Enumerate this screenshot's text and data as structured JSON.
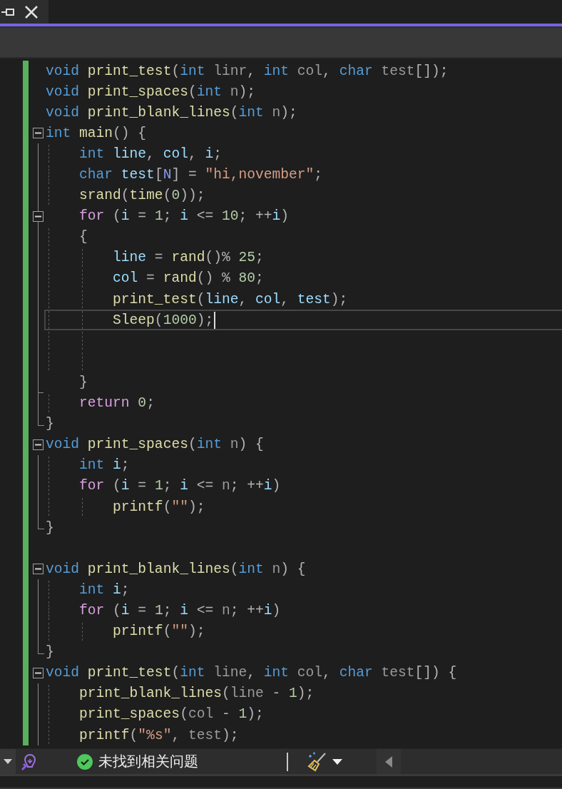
{
  "editor": {
    "lines": [
      {
        "fold_start": false,
        "fold_end": false,
        "current": false,
        "tokens": [
          {
            "kind": "keyword",
            "text": "void"
          },
          {
            "kind": "function",
            "text": " print_test"
          },
          {
            "kind": "punct",
            "text": "("
          },
          {
            "kind": "keyword",
            "text": "int"
          },
          {
            "kind": "param",
            "text": " linr"
          },
          {
            "kind": "punct",
            "text": ", "
          },
          {
            "kind": "keyword",
            "text": "int"
          },
          {
            "kind": "param",
            "text": " col"
          },
          {
            "kind": "punct",
            "text": ", "
          },
          {
            "kind": "keyword",
            "text": "char"
          },
          {
            "kind": "param",
            "text": " test"
          },
          {
            "kind": "punct",
            "text": "[]);"
          }
        ]
      },
      {
        "fold_start": false,
        "fold_end": false,
        "current": false,
        "tokens": [
          {
            "kind": "keyword",
            "text": "void"
          },
          {
            "kind": "function",
            "text": " print_spaces"
          },
          {
            "kind": "punct",
            "text": "("
          },
          {
            "kind": "keyword",
            "text": "int"
          },
          {
            "kind": "param",
            "text": " n"
          },
          {
            "kind": "punct",
            "text": ");"
          }
        ]
      },
      {
        "fold_start": false,
        "fold_end": false,
        "current": false,
        "tokens": [
          {
            "kind": "keyword",
            "text": "void"
          },
          {
            "kind": "function",
            "text": " print_blank_lines"
          },
          {
            "kind": "punct",
            "text": "("
          },
          {
            "kind": "keyword",
            "text": "int"
          },
          {
            "kind": "param",
            "text": " n"
          },
          {
            "kind": "punct",
            "text": ");"
          }
        ]
      },
      {
        "fold_start": true,
        "fold_end": false,
        "current": false,
        "tokens": [
          {
            "kind": "keyword",
            "text": "int"
          },
          {
            "kind": "function",
            "text": " main"
          },
          {
            "kind": "punct",
            "text": "() {"
          }
        ]
      },
      {
        "fold_start": false,
        "fold_end": false,
        "current": false,
        "tokens": [
          {
            "kind": "keyword",
            "text": "    int"
          },
          {
            "kind": "variable",
            "text": " line"
          },
          {
            "kind": "punct",
            "text": ", "
          },
          {
            "kind": "variable",
            "text": "col"
          },
          {
            "kind": "punct",
            "text": ", "
          },
          {
            "kind": "variable",
            "text": "i"
          },
          {
            "kind": "punct",
            "text": ";"
          }
        ]
      },
      {
        "fold_start": false,
        "fold_end": false,
        "current": false,
        "tokens": [
          {
            "kind": "keyword",
            "text": "    char"
          },
          {
            "kind": "variable",
            "text": " test"
          },
          {
            "kind": "punct",
            "text": "["
          },
          {
            "kind": "macro",
            "text": "N"
          },
          {
            "kind": "punct",
            "text": "] = "
          },
          {
            "kind": "string",
            "text": "\"hi,november\""
          },
          {
            "kind": "punct",
            "text": ";"
          }
        ]
      },
      {
        "fold_start": false,
        "fold_end": false,
        "current": false,
        "tokens": [
          {
            "kind": "function",
            "text": "    srand"
          },
          {
            "kind": "punct",
            "text": "("
          },
          {
            "kind": "function",
            "text": "time"
          },
          {
            "kind": "punct",
            "text": "("
          },
          {
            "kind": "number",
            "text": "0"
          },
          {
            "kind": "punct",
            "text": "));"
          }
        ]
      },
      {
        "fold_start": true,
        "fold_end": false,
        "current": false,
        "tokens": [
          {
            "kind": "control",
            "text": "    for"
          },
          {
            "kind": "punct",
            "text": " ("
          },
          {
            "kind": "variable",
            "text": "i"
          },
          {
            "kind": "punct",
            "text": " = "
          },
          {
            "kind": "number",
            "text": "1"
          },
          {
            "kind": "punct",
            "text": "; "
          },
          {
            "kind": "variable",
            "text": "i"
          },
          {
            "kind": "punct",
            "text": " <= "
          },
          {
            "kind": "number",
            "text": "10"
          },
          {
            "kind": "punct",
            "text": "; ++"
          },
          {
            "kind": "variable",
            "text": "i"
          },
          {
            "kind": "punct",
            "text": ")"
          }
        ]
      },
      {
        "fold_start": false,
        "fold_end": false,
        "current": false,
        "tokens": [
          {
            "kind": "punct",
            "text": "    {"
          }
        ]
      },
      {
        "fold_start": false,
        "fold_end": false,
        "current": false,
        "tokens": [
          {
            "kind": "variable",
            "text": "        line"
          },
          {
            "kind": "punct",
            "text": " = "
          },
          {
            "kind": "function",
            "text": "rand"
          },
          {
            "kind": "punct",
            "text": "()% "
          },
          {
            "kind": "number",
            "text": "25"
          },
          {
            "kind": "punct",
            "text": ";"
          }
        ]
      },
      {
        "fold_start": false,
        "fold_end": false,
        "current": false,
        "tokens": [
          {
            "kind": "variable",
            "text": "        col"
          },
          {
            "kind": "punct",
            "text": " = "
          },
          {
            "kind": "function",
            "text": "rand"
          },
          {
            "kind": "punct",
            "text": "() % "
          },
          {
            "kind": "number",
            "text": "80"
          },
          {
            "kind": "punct",
            "text": ";"
          }
        ]
      },
      {
        "fold_start": false,
        "fold_end": false,
        "current": false,
        "tokens": [
          {
            "kind": "function",
            "text": "        print_test"
          },
          {
            "kind": "punct",
            "text": "("
          },
          {
            "kind": "variable",
            "text": "line"
          },
          {
            "kind": "punct",
            "text": ", "
          },
          {
            "kind": "variable",
            "text": "col"
          },
          {
            "kind": "punct",
            "text": ", "
          },
          {
            "kind": "variable",
            "text": "test"
          },
          {
            "kind": "punct",
            "text": ");"
          }
        ]
      },
      {
        "fold_start": false,
        "fold_end": false,
        "current": true,
        "tokens": [
          {
            "kind": "function",
            "text": "        Sleep"
          },
          {
            "kind": "punct",
            "text": "("
          },
          {
            "kind": "number",
            "text": "1000"
          },
          {
            "kind": "punct",
            "text": ");"
          }
        ]
      },
      {
        "fold_start": false,
        "fold_end": false,
        "current": false
      },
      {
        "fold_start": false,
        "fold_end": false,
        "current": false
      },
      {
        "fold_start": false,
        "fold_end": true,
        "current": false,
        "tokens": [
          {
            "kind": "punct",
            "text": "    }"
          }
        ]
      },
      {
        "fold_start": false,
        "fold_end": false,
        "current": false,
        "tokens": [
          {
            "kind": "control",
            "text": "    return"
          },
          {
            "kind": "number",
            "text": " 0"
          },
          {
            "kind": "punct",
            "text": ";"
          }
        ]
      },
      {
        "fold_start": false,
        "fold_end": true,
        "current": false,
        "tokens": [
          {
            "kind": "punct",
            "text": "}"
          }
        ]
      },
      {
        "fold_start": true,
        "fold_end": false,
        "current": false,
        "tokens": [
          {
            "kind": "keyword",
            "text": "void"
          },
          {
            "kind": "function",
            "text": " print_spaces"
          },
          {
            "kind": "punct",
            "text": "("
          },
          {
            "kind": "keyword",
            "text": "int"
          },
          {
            "kind": "param",
            "text": " n"
          },
          {
            "kind": "punct",
            "text": ") {"
          }
        ]
      },
      {
        "fold_start": false,
        "fold_end": false,
        "current": false,
        "tokens": [
          {
            "kind": "keyword",
            "text": "    int"
          },
          {
            "kind": "variable",
            "text": " i"
          },
          {
            "kind": "punct",
            "text": ";"
          }
        ]
      },
      {
        "fold_start": false,
        "fold_end": false,
        "current": false,
        "tokens": [
          {
            "kind": "control",
            "text": "    for"
          },
          {
            "kind": "punct",
            "text": " ("
          },
          {
            "kind": "variable",
            "text": "i"
          },
          {
            "kind": "punct",
            "text": " = "
          },
          {
            "kind": "number",
            "text": "1"
          },
          {
            "kind": "punct",
            "text": "; "
          },
          {
            "kind": "variable",
            "text": "i"
          },
          {
            "kind": "punct",
            "text": " <= "
          },
          {
            "kind": "param",
            "text": "n"
          },
          {
            "kind": "punct",
            "text": "; ++"
          },
          {
            "kind": "variable",
            "text": "i"
          },
          {
            "kind": "punct",
            "text": ")"
          }
        ]
      },
      {
        "fold_start": false,
        "fold_end": false,
        "current": false,
        "tokens": [
          {
            "kind": "function",
            "text": "        printf"
          },
          {
            "kind": "punct",
            "text": "("
          },
          {
            "kind": "string",
            "text": "\"\""
          },
          {
            "kind": "punct",
            "text": ");"
          }
        ]
      },
      {
        "fold_start": false,
        "fold_end": true,
        "current": false,
        "tokens": [
          {
            "kind": "punct",
            "text": "}"
          }
        ]
      },
      {
        "fold_start": false,
        "fold_end": false,
        "current": false
      },
      {
        "fold_start": true,
        "fold_end": false,
        "current": false,
        "tokens": [
          {
            "kind": "keyword",
            "text": "void"
          },
          {
            "kind": "function",
            "text": " print_blank_lines"
          },
          {
            "kind": "punct",
            "text": "("
          },
          {
            "kind": "keyword",
            "text": "int"
          },
          {
            "kind": "param",
            "text": " n"
          },
          {
            "kind": "punct",
            "text": ") {"
          }
        ]
      },
      {
        "fold_start": false,
        "fold_end": false,
        "current": false,
        "tokens": [
          {
            "kind": "keyword",
            "text": "    int"
          },
          {
            "kind": "variable",
            "text": " i"
          },
          {
            "kind": "punct",
            "text": ";"
          }
        ]
      },
      {
        "fold_start": false,
        "fold_end": false,
        "current": false,
        "tokens": [
          {
            "kind": "control",
            "text": "    for"
          },
          {
            "kind": "punct",
            "text": " ("
          },
          {
            "kind": "variable",
            "text": "i"
          },
          {
            "kind": "punct",
            "text": " = "
          },
          {
            "kind": "number",
            "text": "1"
          },
          {
            "kind": "punct",
            "text": "; "
          },
          {
            "kind": "variable",
            "text": "i"
          },
          {
            "kind": "punct",
            "text": " <= "
          },
          {
            "kind": "param",
            "text": "n"
          },
          {
            "kind": "punct",
            "text": "; ++"
          },
          {
            "kind": "variable",
            "text": "i"
          },
          {
            "kind": "punct",
            "text": ")"
          }
        ]
      },
      {
        "fold_start": false,
        "fold_end": false,
        "current": false,
        "tokens": [
          {
            "kind": "function",
            "text": "        printf"
          },
          {
            "kind": "punct",
            "text": "("
          },
          {
            "kind": "string",
            "text": "\"\""
          },
          {
            "kind": "punct",
            "text": ");"
          }
        ]
      },
      {
        "fold_start": false,
        "fold_end": true,
        "current": false,
        "tokens": [
          {
            "kind": "punct",
            "text": "}"
          }
        ]
      },
      {
        "fold_start": true,
        "fold_end": false,
        "current": false,
        "tokens": [
          {
            "kind": "keyword",
            "text": "void"
          },
          {
            "kind": "function",
            "text": " print_test"
          },
          {
            "kind": "punct",
            "text": "("
          },
          {
            "kind": "keyword",
            "text": "int"
          },
          {
            "kind": "param",
            "text": " line"
          },
          {
            "kind": "punct",
            "text": ", "
          },
          {
            "kind": "keyword",
            "text": "int"
          },
          {
            "kind": "param",
            "text": " col"
          },
          {
            "kind": "punct",
            "text": ", "
          },
          {
            "kind": "keyword",
            "text": "char"
          },
          {
            "kind": "param",
            "text": " test"
          },
          {
            "kind": "punct",
            "text": "[]) {"
          }
        ]
      },
      {
        "fold_start": false,
        "fold_end": false,
        "current": false,
        "tokens": [
          {
            "kind": "function",
            "text": "    print_blank_lines"
          },
          {
            "kind": "punct",
            "text": "("
          },
          {
            "kind": "param",
            "text": "line"
          },
          {
            "kind": "punct",
            "text": " - "
          },
          {
            "kind": "number",
            "text": "1"
          },
          {
            "kind": "punct",
            "text": ");"
          }
        ]
      },
      {
        "fold_start": false,
        "fold_end": false,
        "current": false,
        "tokens": [
          {
            "kind": "function",
            "text": "    print_spaces"
          },
          {
            "kind": "punct",
            "text": "("
          },
          {
            "kind": "param",
            "text": "col"
          },
          {
            "kind": "punct",
            "text": " - "
          },
          {
            "kind": "number",
            "text": "1"
          },
          {
            "kind": "punct",
            "text": ");"
          }
        ]
      },
      {
        "fold_start": false,
        "fold_end": false,
        "current": false,
        "tokens": [
          {
            "kind": "function",
            "text": "    printf"
          },
          {
            "kind": "punct",
            "text": "("
          },
          {
            "kind": "string",
            "text": "\"%s\""
          },
          {
            "kind": "punct",
            "text": ", "
          },
          {
            "kind": "param",
            "text": "test"
          },
          {
            "kind": "punct",
            "text": ");"
          }
        ]
      }
    ]
  },
  "status_bar": {
    "issues_text": "未找到相关问题"
  }
}
